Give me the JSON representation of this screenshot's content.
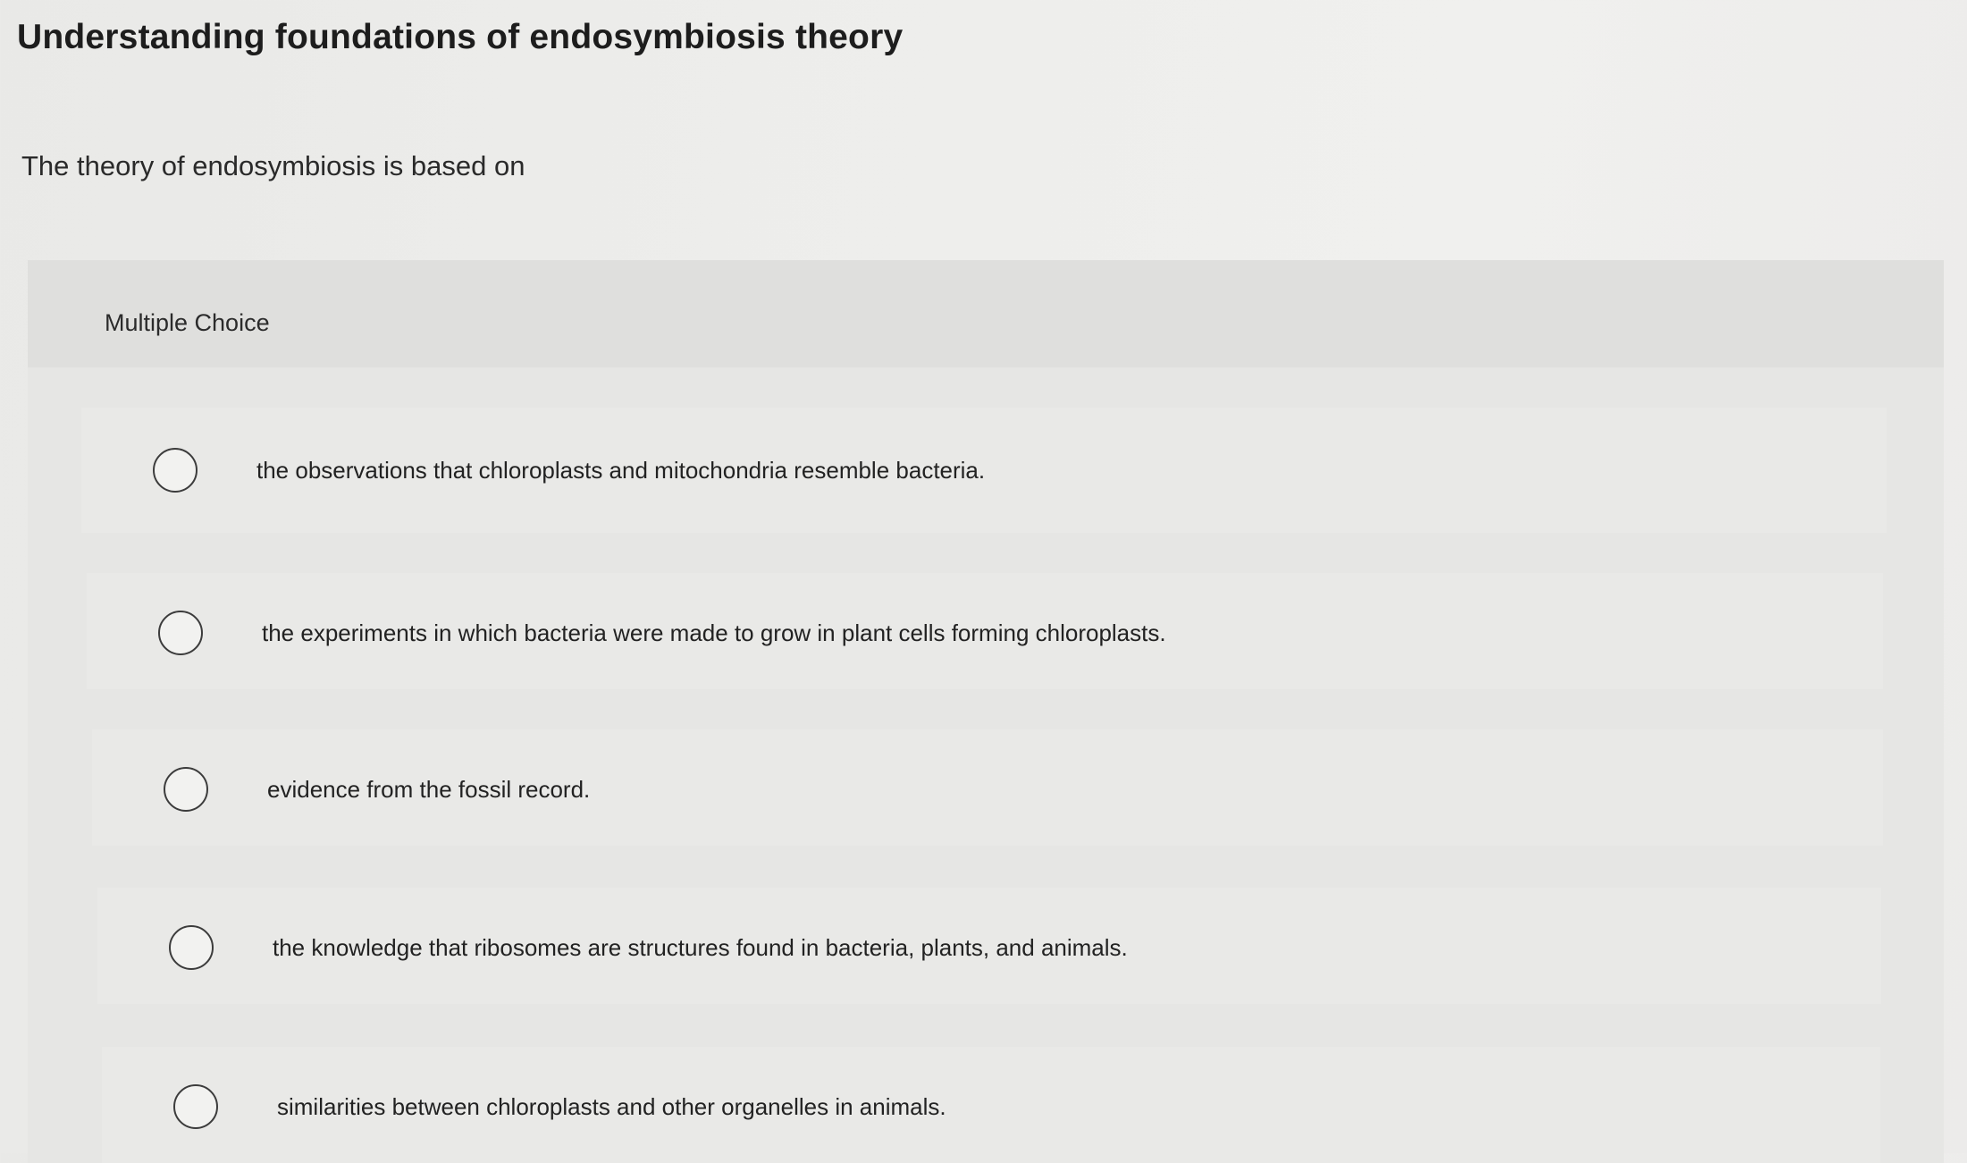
{
  "question": {
    "title": "Understanding foundations of endosymbiosis theory",
    "prompt": "The theory of endosymbiosis is based on"
  },
  "choice_panel": {
    "label": "Multiple Choice",
    "selected_index": null,
    "options": [
      {
        "text": "the observations that chloroplasts and mitochondria resemble bacteria."
      },
      {
        "text": "the experiments in which bacteria were made to grow in plant cells forming chloroplasts."
      },
      {
        "text": "evidence from the fossil record."
      },
      {
        "text": "the knowledge that ribosomes are structures found in bacteria, plants, and animals."
      },
      {
        "text": "similarities between chloroplasts and other organelles in animals."
      }
    ]
  }
}
